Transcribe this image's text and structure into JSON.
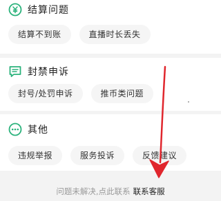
{
  "colors": {
    "accent": "#2ab27b",
    "arrow": "#e0262d"
  },
  "sections": [
    {
      "icon": "wallet-icon",
      "title": "结算问题",
      "chips": [
        "结算不到账",
        "直播时长丢失"
      ]
    },
    {
      "icon": "message-icon",
      "title": "封禁申诉",
      "chips": [
        "封号/处罚申诉",
        "推币类问题"
      ]
    },
    {
      "icon": "more-dots-icon",
      "title": "其他",
      "chips": [
        "违规举报",
        "服务投诉",
        "反馈建议"
      ]
    }
  ],
  "footer": {
    "text": "问题未解决,点此联系",
    "link": "联系客服"
  }
}
